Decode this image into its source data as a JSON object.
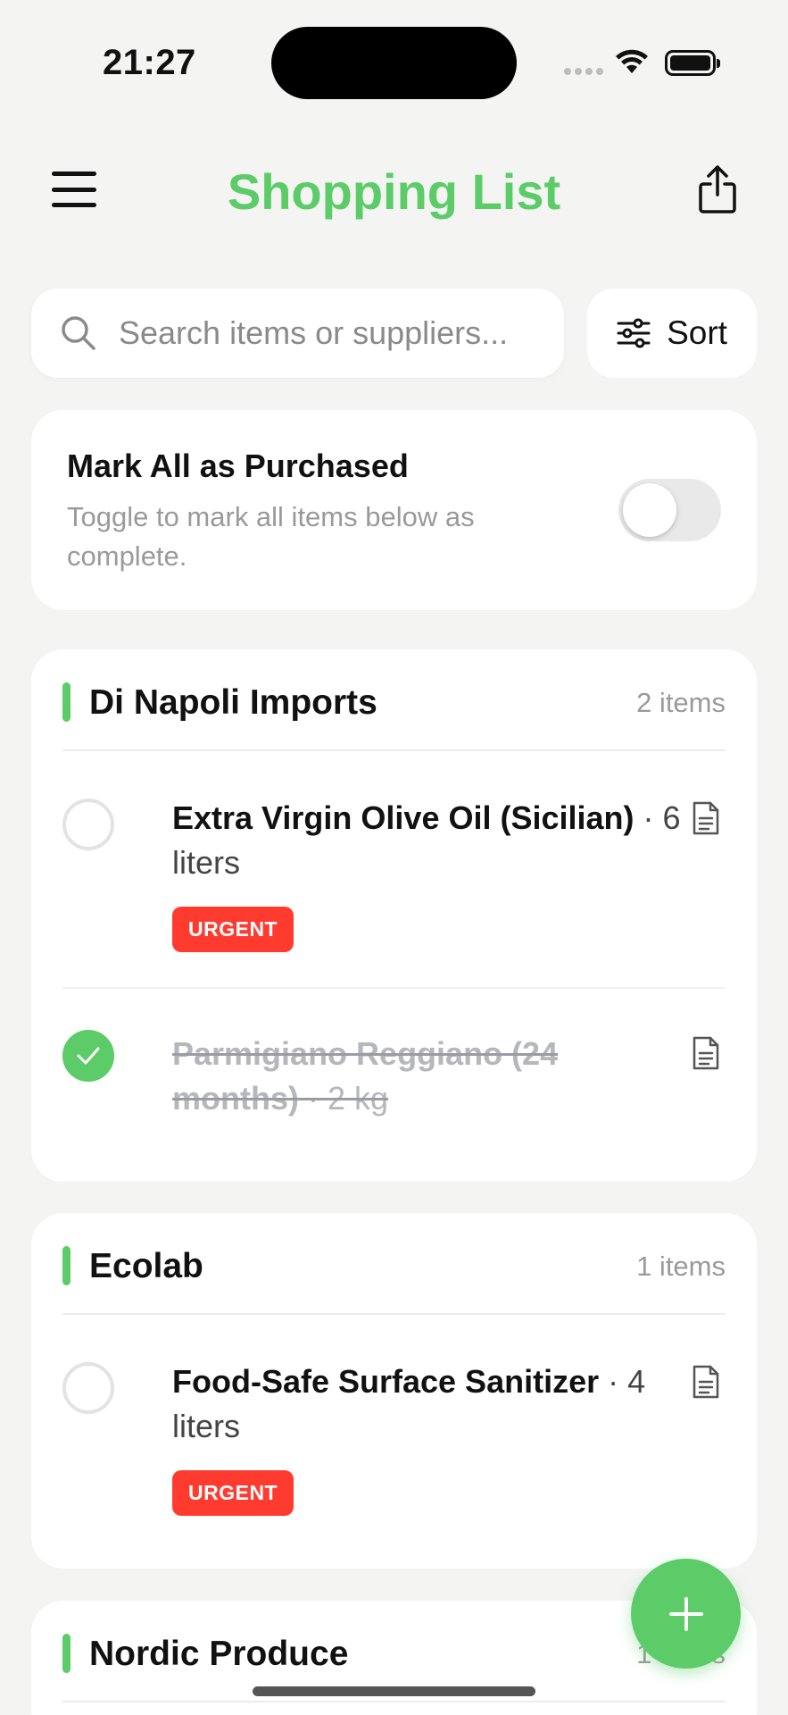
{
  "status_bar": {
    "time": "21:27"
  },
  "header": {
    "title": "Shopping List"
  },
  "search": {
    "placeholder": "Search items or suppliers..."
  },
  "sort": {
    "label": "Sort"
  },
  "mark_all": {
    "title": "Mark All as Purchased",
    "subtitle": "Toggle to mark all items below as complete.",
    "enabled": false
  },
  "groups": [
    {
      "name": "Di Napoli Imports",
      "count": "2 items",
      "items": [
        {
          "name": "Extra Virgin Olive Oil (Sicilian)",
          "qty": " · 6 liters",
          "badge": "URGENT",
          "checked": false
        },
        {
          "name": "Parmigiano Reggiano (24 months)",
          "qty": " · 2 kg",
          "checked": true
        }
      ]
    },
    {
      "name": "Ecolab",
      "count": "1 items",
      "items": [
        {
          "name": "Food-Safe Surface Sanitizer",
          "qty": " · 4 liters",
          "badge": "URGENT",
          "checked": false
        }
      ]
    },
    {
      "name": "Nordic Produce",
      "count": "1 items",
      "items": []
    }
  ],
  "colors": {
    "accent": "#5bcc67",
    "urgent": "#ff3b30",
    "background": "#f4f4f3"
  },
  "icons": [
    "menu-icon",
    "share-icon",
    "search-icon",
    "sliders-icon",
    "document-icon",
    "check-icon",
    "plus-icon"
  ]
}
